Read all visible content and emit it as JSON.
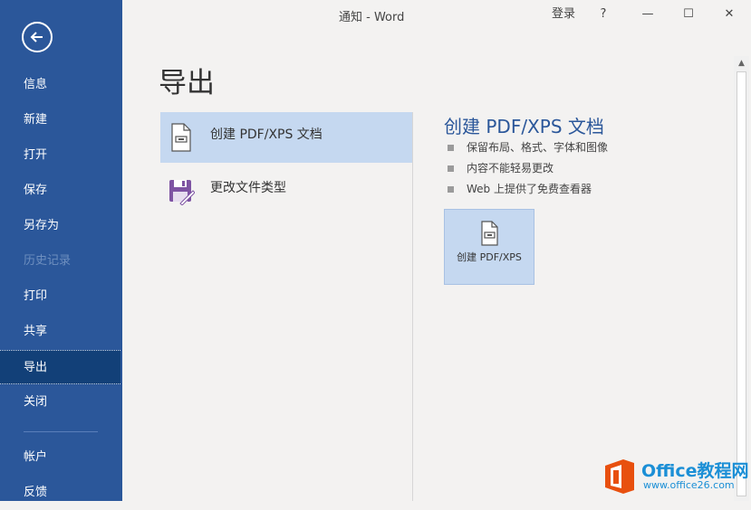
{
  "window": {
    "title": "通知 - Word",
    "signin": "登录",
    "help": "?",
    "minimize": "—",
    "maximize": "☐",
    "close": "✕"
  },
  "sidebar": {
    "items": [
      {
        "label": "信息"
      },
      {
        "label": "新建"
      },
      {
        "label": "打开"
      },
      {
        "label": "保存"
      },
      {
        "label": "另存为"
      },
      {
        "label": "历史记录"
      },
      {
        "label": "打印"
      },
      {
        "label": "共享"
      },
      {
        "label": "导出"
      },
      {
        "label": "关闭"
      },
      {
        "label": "帐户"
      },
      {
        "label": "反馈"
      }
    ],
    "active": "导出",
    "disabled": "历史记录"
  },
  "main": {
    "title": "导出",
    "options": [
      {
        "label": "创建 PDF/XPS 文档",
        "icon": "document-icon"
      },
      {
        "label": "更改文件类型",
        "icon": "save-as-icon"
      }
    ],
    "detail": {
      "title": "创建 PDF/XPS 文档",
      "bullets": [
        "保留布局、格式、字体和图像",
        "内容不能轻易更改",
        "Web 上提供了免费查看器"
      ],
      "button_label": "创建 PDF/XPS"
    }
  },
  "watermark": {
    "text1": "Office教程网",
    "text2": "www.office26.com"
  },
  "colors": {
    "sidebar": "#2b579a",
    "active": "#124078",
    "selected": "#c5d8f0",
    "accent_title": "#2b579a",
    "logo_orange": "#e8500f"
  }
}
